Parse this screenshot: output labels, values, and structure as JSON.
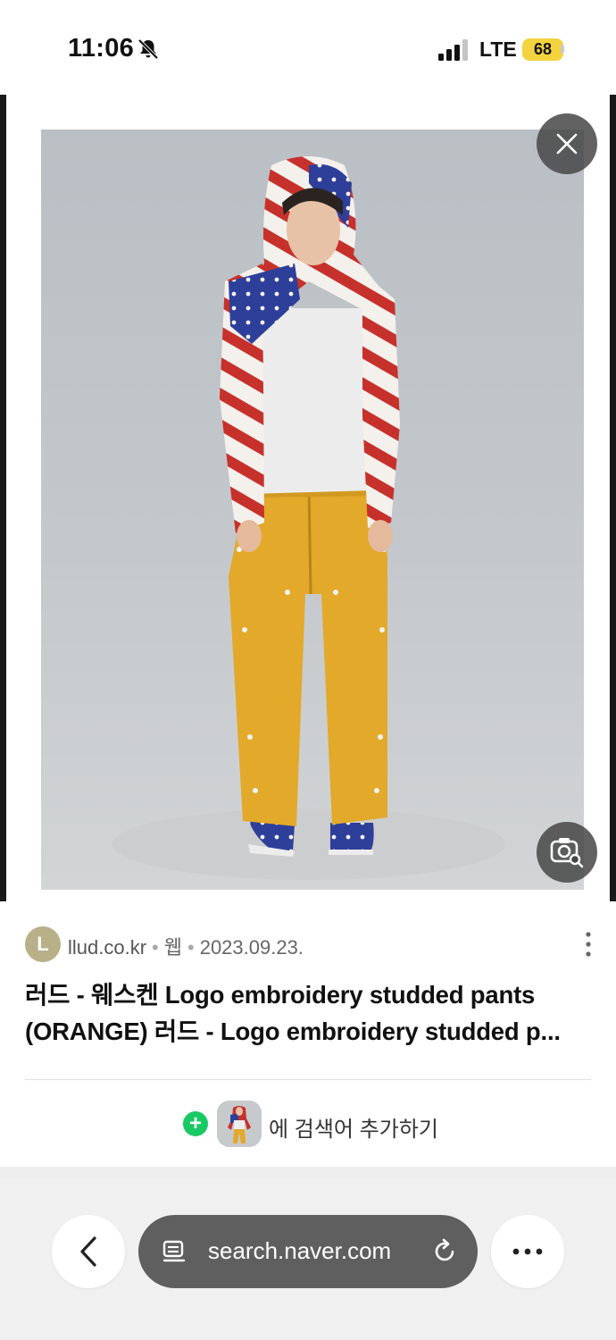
{
  "status_bar": {
    "time": "11:06",
    "network": "LTE",
    "battery": "68",
    "icons": [
      "bell-off-icon",
      "signal-icon",
      "battery-icon"
    ]
  },
  "viewer": {
    "icons": [
      "close-icon",
      "lens-search-icon"
    ]
  },
  "result": {
    "avatar_letter": "L",
    "domain": "llud.co.kr",
    "category": "웹",
    "date": "2023.09.23.",
    "title": "러드 - 웨스켄 Logo embroidery studded pants (ORANGE) 러드 - Logo embroidery studded p...",
    "add_keyword_label": "에 검색어 추가하기",
    "icons": [
      "more-vert-icon",
      "plus-icon"
    ]
  },
  "browser_bar": {
    "url": "search.naver.com",
    "icons": [
      "back-icon",
      "page-icon",
      "reload-icon",
      "more-icon"
    ]
  },
  "colors": {
    "battery": "#f3d33e",
    "plus": "#18c964",
    "url_pill": "#5f5f5f"
  }
}
